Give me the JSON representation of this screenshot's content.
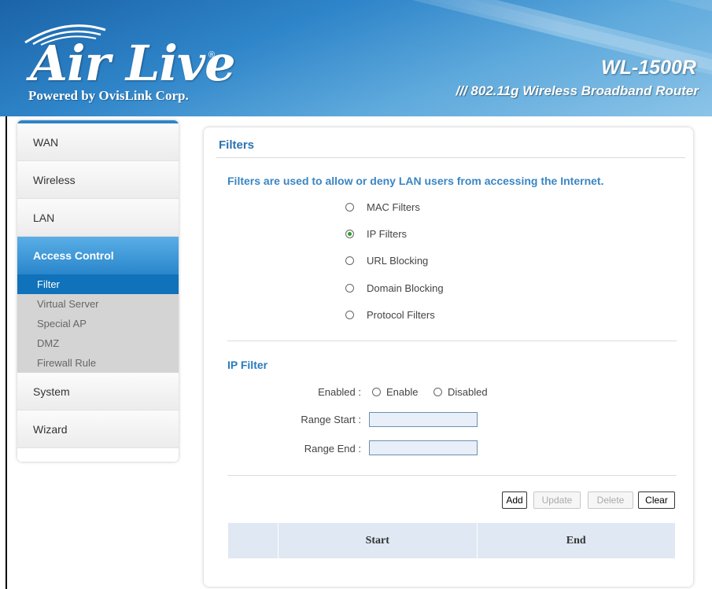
{
  "header": {
    "logo": "Air Live",
    "logo_reg": "®",
    "tagline": "Powered by OvisLink Corp.",
    "model": "WL-1500R",
    "model_sub": "/// 802.11g Wireless Broadband Router"
  },
  "sidebar": {
    "items": [
      {
        "label": "WAN"
      },
      {
        "label": "Wireless"
      },
      {
        "label": "LAN"
      },
      {
        "label": "Access Control",
        "active": true
      },
      {
        "label": "System"
      },
      {
        "label": "Wizard"
      }
    ],
    "subitems": [
      {
        "label": "Filter",
        "active": true
      },
      {
        "label": "Virtual Server"
      },
      {
        "label": "Special AP"
      },
      {
        "label": "DMZ"
      },
      {
        "label": "Firewall Rule"
      }
    ]
  },
  "main": {
    "title": "Filters",
    "description": "Filters are used to allow or deny LAN users from accessing the Internet.",
    "filter_types": [
      {
        "label": "MAC Filters",
        "checked": false
      },
      {
        "label": "IP Filters",
        "checked": true
      },
      {
        "label": "URL Blocking",
        "checked": false
      },
      {
        "label": "Domain Blocking",
        "checked": false
      },
      {
        "label": "Protocol Filters",
        "checked": false
      }
    ],
    "ip_filter": {
      "title": "IP Filter",
      "enabled_label": "Enabled :",
      "enable_option": "Enable",
      "disabled_option": "Disabled",
      "range_start_label": "Range Start :",
      "range_start_value": "",
      "range_end_label": "Range End :",
      "range_end_value": ""
    },
    "buttons": {
      "add": "Add",
      "update": "Update",
      "delete": "Delete",
      "clear": "Clear"
    },
    "table": {
      "columns": [
        "",
        "Start",
        "End"
      ]
    }
  },
  "colors": {
    "accent": "#2973b3",
    "sidebar_active": "#2a86cb",
    "banner": "#2f85c9"
  }
}
